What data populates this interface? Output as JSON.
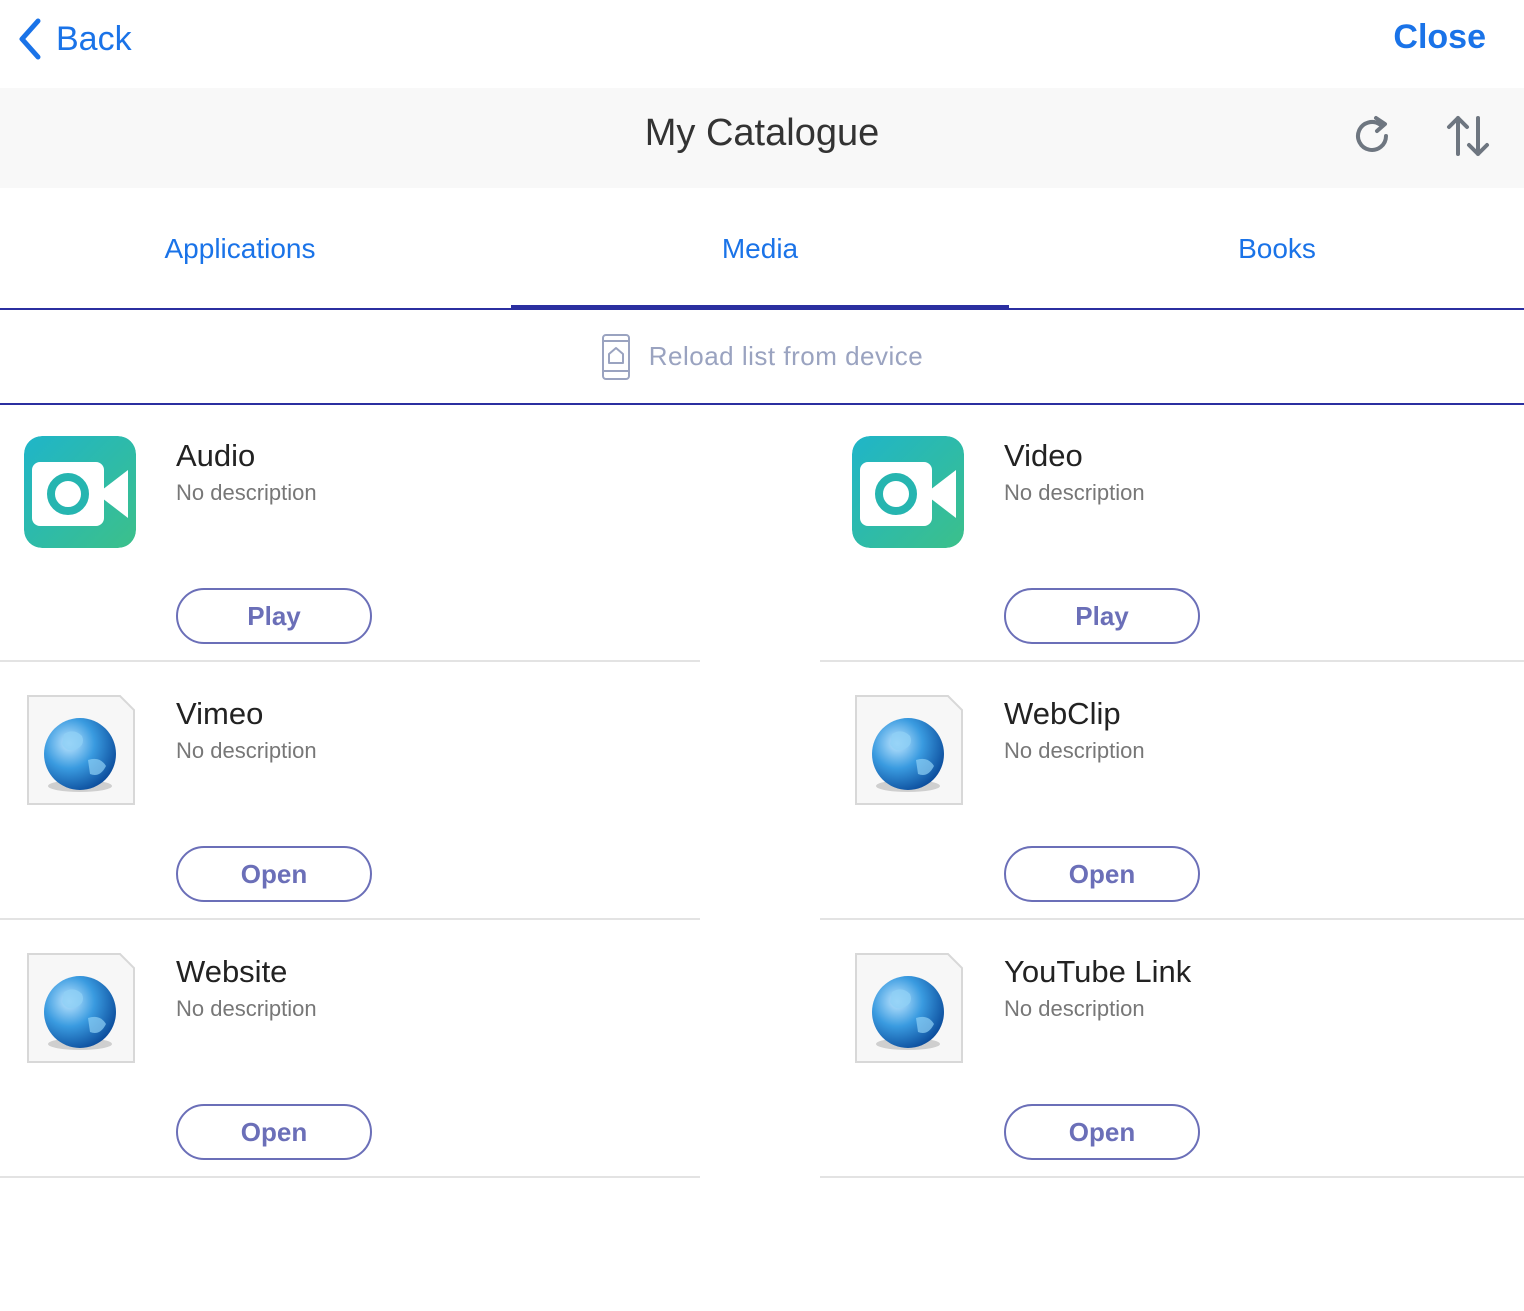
{
  "nav": {
    "back_label": "Back",
    "close_label": "Close"
  },
  "header": {
    "title": "My Catalogue"
  },
  "tabs": [
    {
      "label": "Applications"
    },
    {
      "label": "Media"
    },
    {
      "label": "Books"
    }
  ],
  "active_tab": "Media",
  "reload": {
    "label": "Reload list from device"
  },
  "items": [
    {
      "name": "Audio",
      "description": "No description",
      "action": "Play",
      "icon": "video-camera-icon"
    },
    {
      "name": "Video",
      "description": "No description",
      "action": "Play",
      "icon": "video-camera-icon"
    },
    {
      "name": "Vimeo",
      "description": "No description",
      "action": "Open",
      "icon": "globe-icon"
    },
    {
      "name": "WebClip",
      "description": "No description",
      "action": "Open",
      "icon": "globe-icon"
    },
    {
      "name": "Website",
      "description": "No description",
      "action": "Open",
      "icon": "globe-icon"
    },
    {
      "name": "YouTube Link",
      "description": "No description",
      "action": "Open",
      "icon": "globe-icon"
    }
  ],
  "colors": {
    "accent": "#1a73e8",
    "tab_indicator": "#2b2fa0",
    "button": "#6b6fb8"
  }
}
